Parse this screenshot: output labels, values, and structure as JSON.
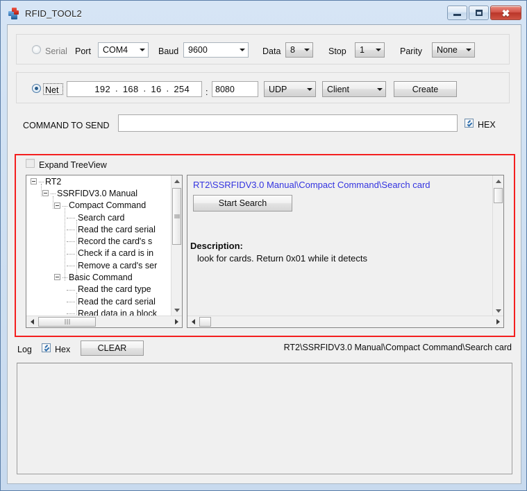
{
  "window": {
    "title": "RFID_TOOL2",
    "icon": "app-cubes-icon",
    "buttons": {
      "minimize": "minimize-icon",
      "maximize": "maximize-icon",
      "close": "close-icon"
    }
  },
  "serial_group": {
    "radio_label": "Serial",
    "radio_selected": false,
    "port": {
      "label": "Port",
      "value": "COM4"
    },
    "baud": {
      "label": "Baud",
      "value": "9600"
    },
    "data": {
      "label": "Data",
      "value": "8"
    },
    "stop": {
      "label": "Stop",
      "value": "1"
    },
    "parity": {
      "label": "Parity",
      "value": "None"
    }
  },
  "net_group": {
    "radio_label": "Net",
    "radio_selected": true,
    "ip": {
      "o1": "192",
      "o2": "168",
      "o3": "16",
      "o4": "254",
      "sep": "."
    },
    "colon": ":",
    "port": "8080",
    "protocol": "UDP",
    "mode": "Client",
    "create_button": "Create"
  },
  "command_row": {
    "label": "COMMAND TO SEND",
    "value": "",
    "placeholder": "",
    "hex_label": "HEX",
    "hex_checked": true
  },
  "tree_section": {
    "expand_label": "Expand TreeView",
    "expand_checked": false,
    "nodes": [
      {
        "label": "RT2",
        "depth": 0,
        "expander": true
      },
      {
        "label": "SSRFIDV3.0 Manual",
        "depth": 1,
        "expander": true
      },
      {
        "label": "Compact Command",
        "depth": 2,
        "expander": true
      },
      {
        "label": "Search card",
        "depth": 3,
        "expander": false
      },
      {
        "label": "Read the card serial",
        "depth": 3,
        "expander": false
      },
      {
        "label": "Record the card's s",
        "depth": 3,
        "expander": false
      },
      {
        "label": "Check if a card is in",
        "depth": 3,
        "expander": false
      },
      {
        "label": "Remove a card's ser",
        "depth": 3,
        "expander": false
      },
      {
        "label": "Basic Command",
        "depth": 2,
        "expander": true
      },
      {
        "label": "Read the card type",
        "depth": 3,
        "expander": false
      },
      {
        "label": "Read the card serial",
        "depth": 3,
        "expander": false
      },
      {
        "label": "Read data in a block",
        "depth": 3,
        "expander": false
      }
    ]
  },
  "detail_panel": {
    "breadcrumb": "RT2\\SSRFIDV3.0 Manual\\Compact Command\\Search card",
    "breadcrumb_color": "#3333e0",
    "action_button": "Start Search",
    "description_label": "Description:",
    "description_text": "look for cards. Return 0x01 while it detects"
  },
  "log_section": {
    "label": "Log",
    "hex_label": "Hex",
    "hex_checked": true,
    "clear_button": "CLEAR",
    "breadcrumb": "RT2\\SSRFIDV3.0 Manual\\Compact Command\\Search card",
    "content": ""
  },
  "annotation": {
    "highlight_color": "#f41f1f"
  }
}
